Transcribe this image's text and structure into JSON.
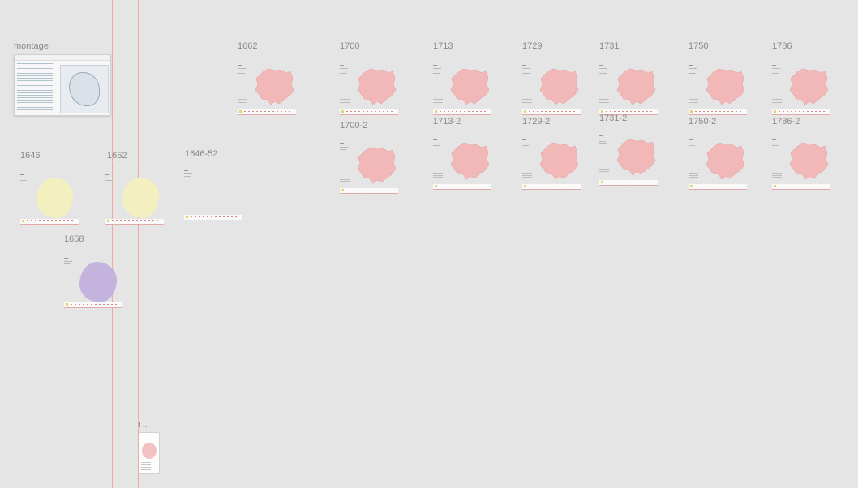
{
  "canvas": {
    "frames": {
      "montage": "montage",
      "f1646": "1646",
      "f1652": "1652",
      "f1646_52": "1646-52",
      "f1658": "1658",
      "f1662": "1662",
      "f1700": "1700",
      "f1700_2": "1700-2",
      "f1713": "1713",
      "f1713_2": "1713-2",
      "f1729": "1729",
      "f1729_2": "1729-2",
      "f1731": "1731",
      "f1731_2": "1731-2",
      "f1750": "1750",
      "f1750_2": "1750-2",
      "f1786": "1786",
      "f1786_2": "1786-2"
    },
    "phone_frame_label": "I ..."
  },
  "colors": {
    "canvas_bg": "#e5e5e5",
    "guide": "#f0a99e",
    "yellow_blob": "#f3efbf",
    "purple_blob": "#c4b3dc",
    "map_fill": "#f2b8b8"
  }
}
